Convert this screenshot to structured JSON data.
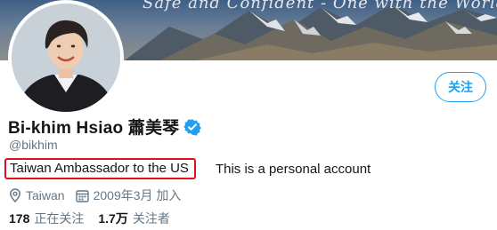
{
  "profile": {
    "banner_text": "Safe and Confident - One with the World",
    "name": "Bi-khim Hsiao 蕭美琴",
    "handle": "@bikhim",
    "bio_title": "Taiwan Ambassador to the US",
    "bio_note": "This is a personal account",
    "location": "Taiwan",
    "joined": "2009年3月 加入",
    "following_count": "178",
    "following_label": "正在关注",
    "followers_count": "1.7万",
    "followers_label": "关注者"
  },
  "actions": {
    "follow_label": "关注"
  },
  "icons": {
    "verified": "verified-badge-icon",
    "location": "location-pin-icon",
    "calendar": "calendar-icon"
  },
  "colors": {
    "accent": "#1da1f2",
    "highlight_box": "#e0101a",
    "secondary_text": "#657786",
    "primary_text": "#14171a"
  }
}
